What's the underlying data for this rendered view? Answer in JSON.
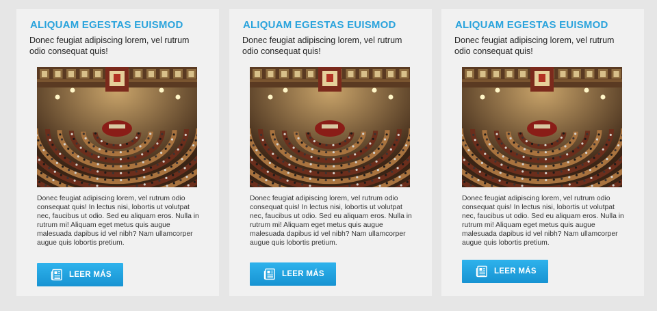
{
  "cards": [
    {
      "title": "ALIQUAM EGESTAS EUISMOD",
      "subtitle": "Donec feugiat adipiscing lorem, vel rutrum odio consequat quis!",
      "body": "Donec feugiat adipiscing lorem, vel rutrum odio consequat quis! In lectus nisi, lobortis ut volutpat nec, faucibus ut odio. Sed eu aliquam eros. Nulla in rutrum mi! Aliquam eget metus quis augue malesuada dapibus id vel nibh? Nam ullamcorper augue quis lobortis pretium.",
      "button_label": "LEER MÁS",
      "button_icon": "newspaper-icon",
      "image": "parliament-chamber-photo"
    },
    {
      "title": "ALIQUAM EGESTAS EUISMOD",
      "subtitle": "Donec feugiat adipiscing lorem, vel rutrum odio consequat quis!",
      "body": "Donec feugiat adipiscing lorem, vel rutrum odio consequat quis! In lectus nisi, lobortis ut volutpat nec, faucibus ut odio. Sed eu aliquam eros. Nulla in rutrum mi! Aliquam eget metus quis augue malesuada dapibus id vel nibh? Nam ullamcorper augue quis lobortis pretium.",
      "button_label": "LEER MÁS",
      "button_icon": "newspaper-icon",
      "image": "parliament-chamber-photo"
    },
    {
      "title": "ALIQUAM EGESTAS EUISMOD",
      "subtitle": "Donec feugiat adipiscing lorem, vel rutrum odio consequat quis!",
      "body": "Donec feugiat adipiscing lorem, vel rutrum odio consequat quis! In lectus nisi, lobortis ut volutpat nec, faucibus ut odio. Sed eu aliquam eros. Nulla in rutrum mi! Aliquam eget metus quis augue malesuada dapibus id vel nibh? Nam ullamcorper augue quis lobortis pretium.",
      "button_label": "LEER MÁS",
      "button_icon": "newspaper-icon",
      "image": "parliament-chamber-photo"
    }
  ],
  "colors": {
    "page_background": "#e6e6e6",
    "card_background": "#f1f1f1",
    "title_accent": "#2aa3dc",
    "button_top": "#2eb2ec",
    "button_bottom": "#1793d2"
  }
}
